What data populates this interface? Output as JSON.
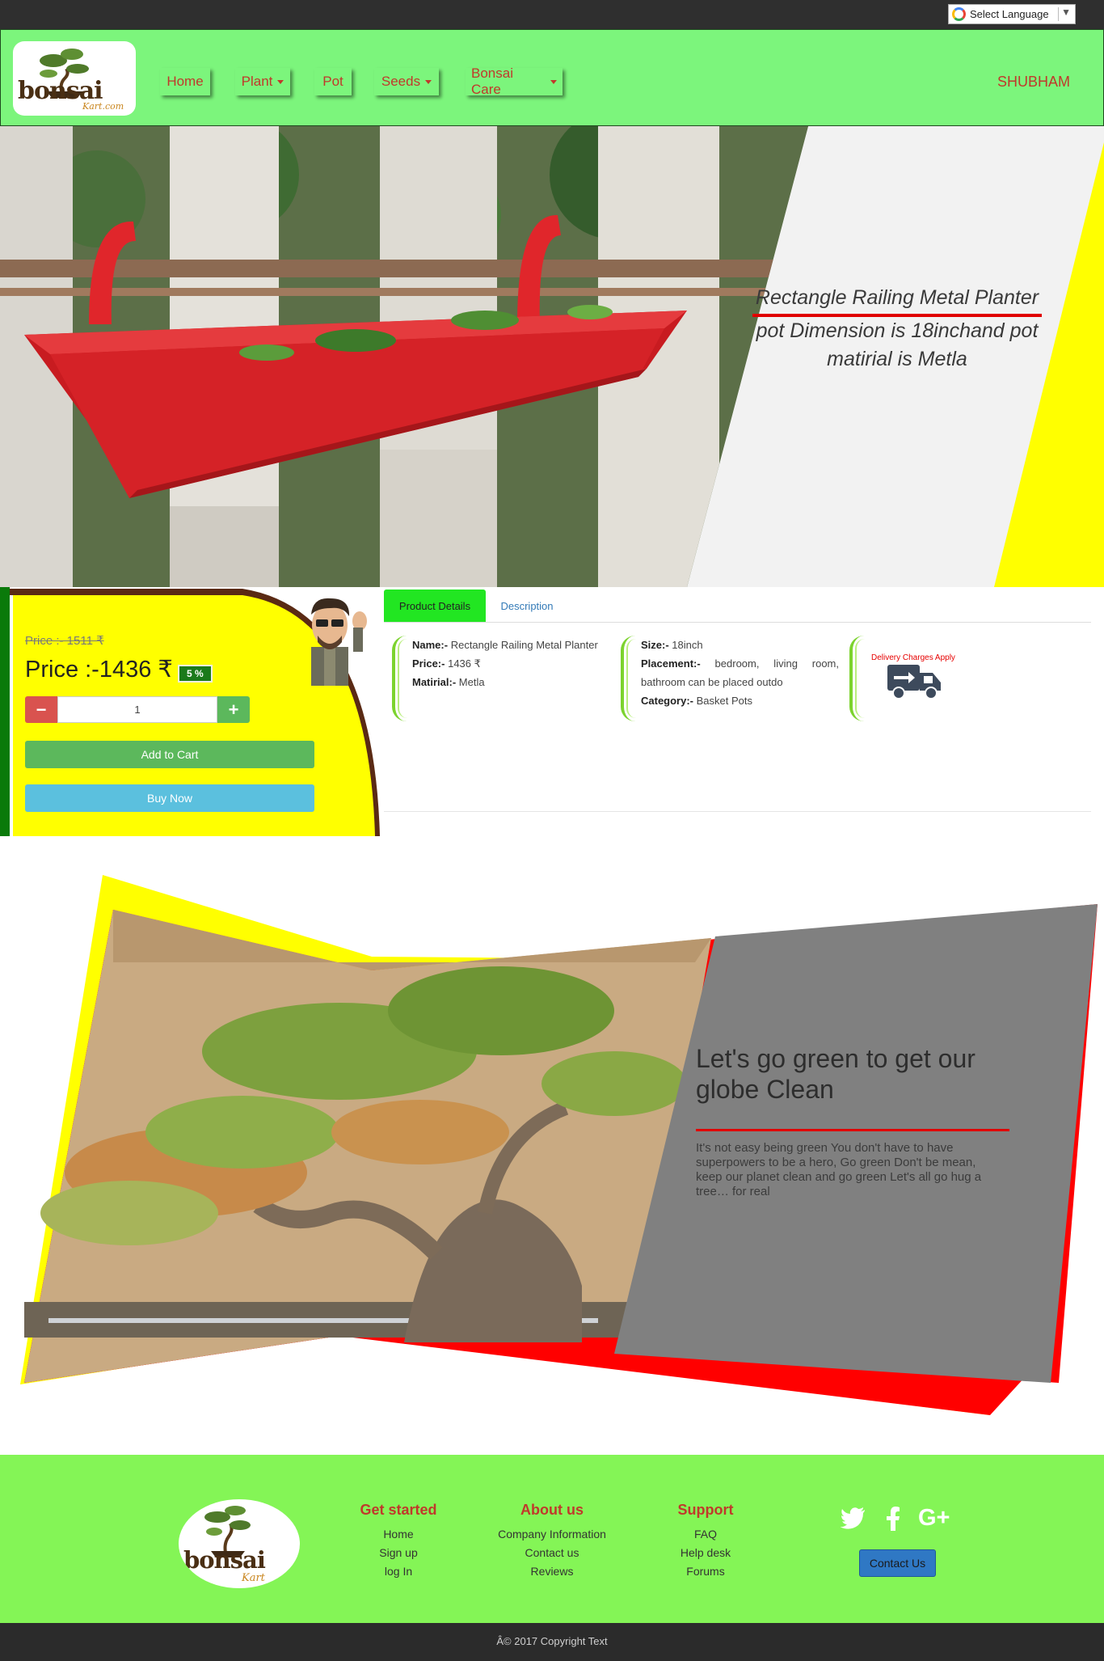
{
  "language": {
    "label": "Select Language"
  },
  "logo": {
    "word": "bonsai",
    "sub": "Kart.com"
  },
  "nav": {
    "items": [
      {
        "label": "Home",
        "dropdown": false
      },
      {
        "label": "Plant",
        "dropdown": true
      },
      {
        "label": "Pot",
        "dropdown": false
      },
      {
        "label": "Seeds",
        "dropdown": true
      },
      {
        "label": "Bonsai Care",
        "dropdown": true
      }
    ],
    "user": "SHUBHAM"
  },
  "hero": {
    "title": "Rectangle Railing Metal Planter",
    "line2": "pot Dimension is 18inchand pot",
    "line3": "matirial is Metla"
  },
  "price": {
    "old": "Price :- 1511 ₹",
    "current": "Price :-1436 ₹",
    "discount": "5 %",
    "quantity": "1",
    "minus": "−",
    "plus": "+",
    "add_to_cart": "Add to Cart",
    "buy_now": "Buy Now"
  },
  "tabs": {
    "active": "Product Details",
    "other": "Description"
  },
  "details": {
    "name_label": "Name:-",
    "name_value": "Rectangle Railing Metal Planter",
    "price_label": "Price:-",
    "price_value": "1436 ₹",
    "material_label": "Matirial:-",
    "material_value": "Metla",
    "size_label": "Size:-",
    "size_value": "18inch",
    "placement_label": "Placement:-",
    "placement_value": "bedroom, living room, bathroom can be placed outdo",
    "category_label": "Category:-",
    "category_value": "Basket Pots",
    "delivery": "Delivery Charges Apply"
  },
  "banner": {
    "heading": "Let's go green to get our globe Clean",
    "body": "It's not easy being green You don't have to have superpowers to be a hero, Go green Don't be mean, keep our planet clean and go green Let's all go hug a tree… for real"
  },
  "footer": {
    "logo_word": "bonsai",
    "logo_sub": "Kart",
    "columns": [
      {
        "title": "Get started",
        "links": [
          "Home",
          "Sign up",
          "log In"
        ]
      },
      {
        "title": "About us",
        "links": [
          "Company Information",
          "Contact us",
          "Reviews"
        ]
      },
      {
        "title": "Support",
        "links": [
          "FAQ",
          "Help desk",
          "Forums"
        ]
      }
    ],
    "social_icons": [
      "twitter-icon",
      "facebook-icon",
      "google-plus-icon"
    ],
    "contact_button": "Contact Us",
    "copyright": "Â© 2017 Copyright Text"
  },
  "colors": {
    "nav_green": "#7cf57c",
    "accent_red": "#c0392b",
    "hero_yellow": "#ffff00",
    "footer_green": "#84f556",
    "banner_gray": "#808080",
    "dark_bar": "#2f2f2f"
  }
}
